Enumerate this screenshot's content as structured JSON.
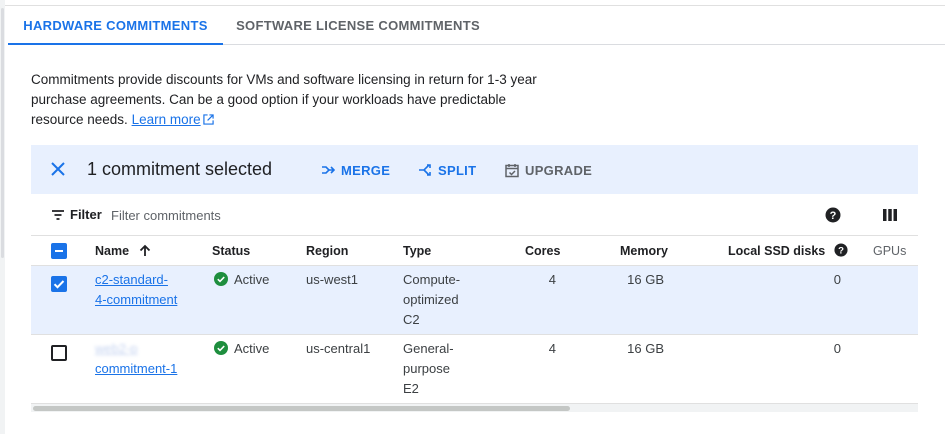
{
  "tabs": [
    {
      "label": "HARDWARE COMMITMENTS",
      "active": true
    },
    {
      "label": "SOFTWARE LICENSE COMMITMENTS",
      "active": false
    }
  ],
  "description": {
    "text": "Commitments provide discounts for VMs and software licensing in return for 1-3 year purchase agreements. Can be a good option if your workloads have predictable resource needs.",
    "learn_more": "Learn more"
  },
  "selection": {
    "count_text": "1 commitment selected",
    "actions": {
      "merge": "MERGE",
      "split": "SPLIT",
      "upgrade": "UPGRADE"
    }
  },
  "filter": {
    "label": "Filter",
    "placeholder": "Filter commitments"
  },
  "table": {
    "columns": {
      "name": "Name",
      "status": "Status",
      "region": "Region",
      "type": "Type",
      "cores": "Cores",
      "memory": "Memory",
      "local_ssd": "Local SSD disks",
      "gpus": "GPUs"
    },
    "rows": [
      {
        "selected": true,
        "name_line1": "c2-standard-",
        "name_line2": "4-commitment",
        "status": "Active",
        "region": "us-west1",
        "type_line1": "Compute-",
        "type_line2": "optimized",
        "type_line3": "C2",
        "cores": "4",
        "memory": "16 GB",
        "local_ssd": "0"
      },
      {
        "selected": false,
        "name_line1": "web2-p",
        "name_line2": "commitment-1",
        "status": "Active",
        "region": "us-central1",
        "type_line1": "General-",
        "type_line2": "purpose",
        "type_line3": "E2",
        "cores": "4",
        "memory": "16 GB",
        "local_ssd": "0"
      }
    ]
  },
  "colors": {
    "accent": "#1a73e8",
    "selected_bg": "#e8f0fe",
    "success": "#1e8e3e"
  }
}
